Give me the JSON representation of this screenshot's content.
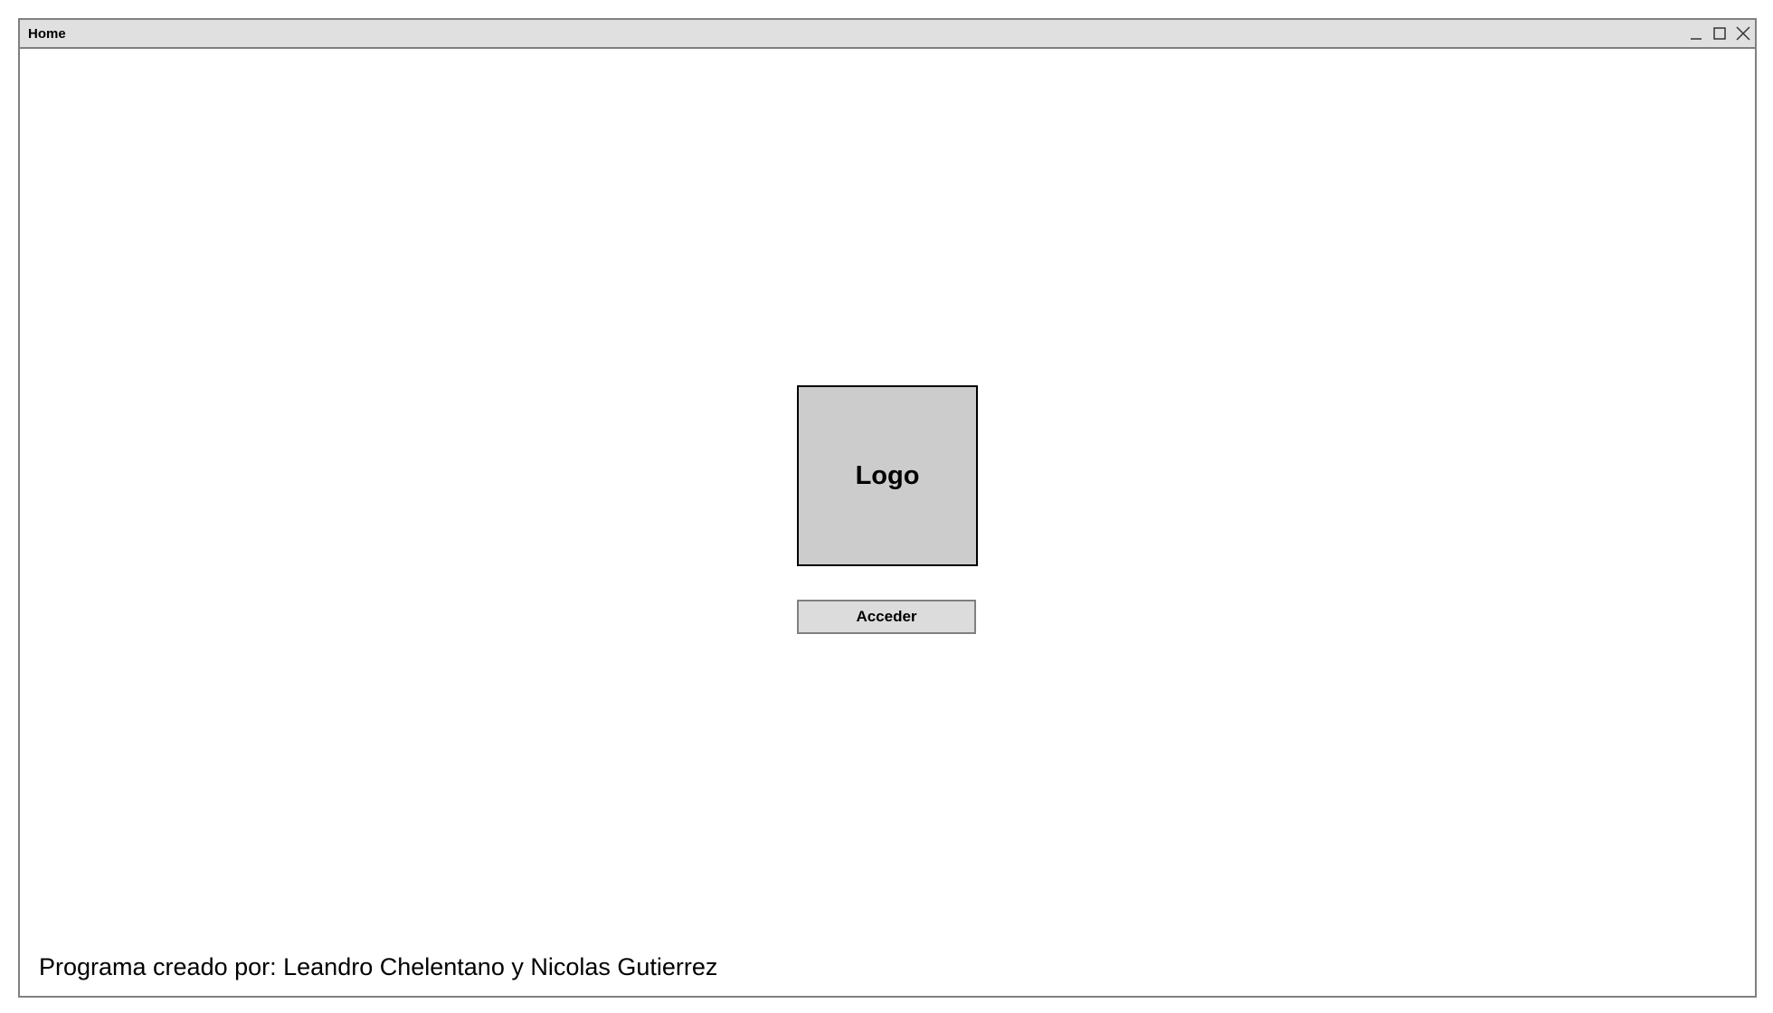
{
  "window": {
    "title": "Home",
    "controls": [
      {
        "icon": "minimize-icon"
      },
      {
        "icon": "maximize-icon"
      },
      {
        "icon": "close-icon"
      }
    ]
  },
  "main": {
    "logo_label": "Logo",
    "access_button_label": "Acceder",
    "credits_text": "Programa creado por: Leandro Chelentano y Nicolas Gutierrez"
  },
  "colors": {
    "titlebar_bg": "#e0e0e0",
    "border": "#808080",
    "logo_bg": "#cccccc",
    "button_bg": "#dcdcdc"
  }
}
